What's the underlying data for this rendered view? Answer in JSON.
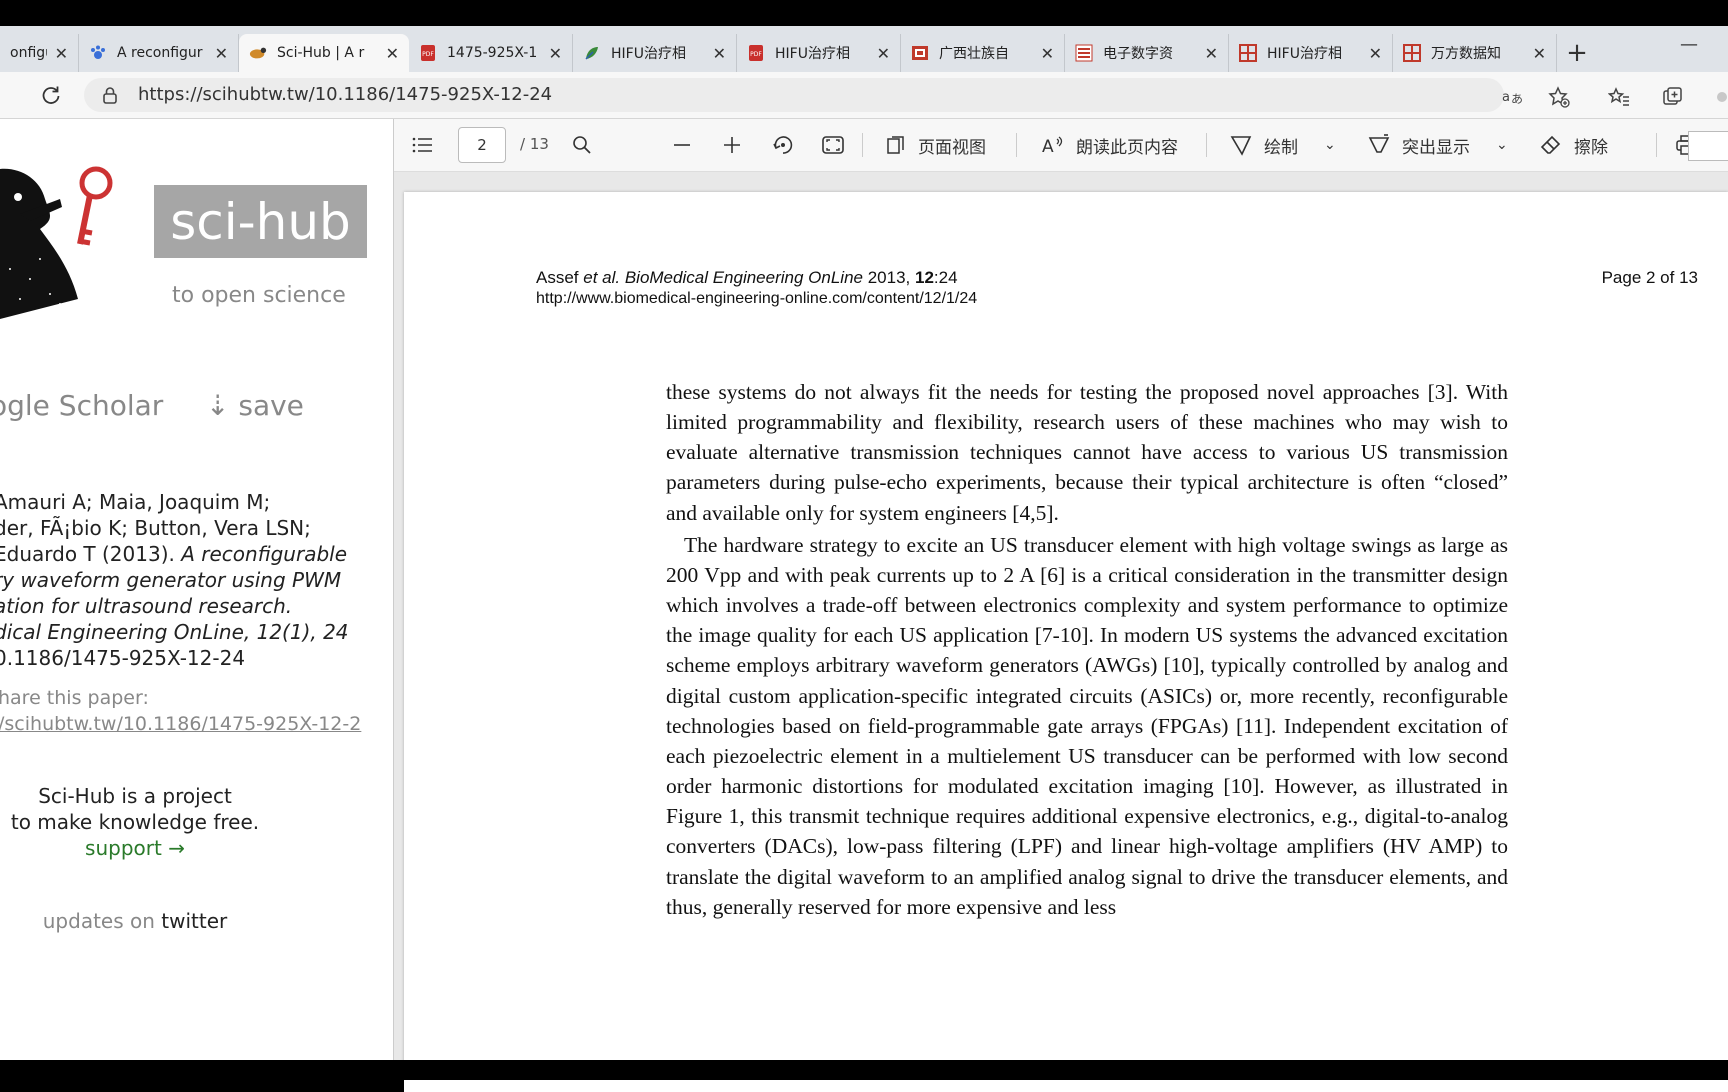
{
  "tabs": [
    {
      "label": "onfigur",
      "icon": "document-icon"
    },
    {
      "label": "A reconfigur",
      "icon": "paw-icon"
    },
    {
      "label": "Sci-Hub | A r",
      "icon": "scihub-icon",
      "active": true
    },
    {
      "label": "1475-925X-1",
      "icon": "pdf-icon"
    },
    {
      "label": "HIFU治疗相",
      "icon": "leaf-icon"
    },
    {
      "label": "HIFU治疗相",
      "icon": "pdf-icon"
    },
    {
      "label": "广西壮族自",
      "icon": "library-icon"
    },
    {
      "label": "电子数字资",
      "icon": "resource-icon"
    },
    {
      "label": "HIFU治疗相",
      "icon": "wanfang-icon"
    },
    {
      "label": "万方数据知",
      "icon": "wanfang-icon"
    }
  ],
  "address": {
    "url": "https://scihubtw.tw/10.1186/1475-925X-12-24"
  },
  "sidebar": {
    "brand": "sci-hub",
    "tagline": "to open science",
    "google_scholar": "ogle Scholar",
    "save": "⇣ save",
    "citation": {
      "line1": "Amauri A; Maia, Joaquim M;",
      "line2": "der, FÃ¡bio K; Button, Vera LSN;",
      "line3_prefix": "Eduardo T (2013). ",
      "line3_italic": "A reconfigurable",
      "line4": "ry waveform generator using PWM",
      "line5": "ation for ultrasound research.",
      "line6": "dical Engineering OnLine, 12(1), 24",
      "line7": "0.1186/1475-925X-12-24"
    },
    "share_label": "hare this paper:",
    "share_link": "/scihubtw.tw/10.1186/1475-925X-12-2",
    "project_line1": "Sci-Hub is a project",
    "project_line2": "to make knowledge free.",
    "support": "support →",
    "updates_prefix": "updates on ",
    "updates_link": "twitter"
  },
  "pdf_toolbar": {
    "current_page": "2",
    "total_pages": "/ 13",
    "page_view": "页面视图",
    "read_aloud": "朗读此页内容",
    "draw": "绘制",
    "highlight": "突出显示",
    "erase": "擦除"
  },
  "pdf_page": {
    "header_line1_a": "Assef ",
    "header_line1_b": "et al. BioMedical Engineering OnLine",
    "header_line1_c": " 2013, ",
    "header_line1_d": "12",
    "header_line1_e": ":24",
    "header_line2": "http://www.biomedical-engineering-online.com/content/12/1/24",
    "page_label": "Page 2 of 13",
    "para1": "these systems do not always fit the needs for testing the proposed novel approaches [3]. With limited programmability and flexibility, research users of these machines who may wish to evaluate alternative transmission techniques cannot have access to various US transmission parameters during pulse-echo experiments, because their typical architecture is often “closed” and available only for system engineers [4,5].",
    "para2": "The hardware strategy to excite an US transducer element with high voltage swings as large as 200 Vpp and with peak currents up to 2 A [6] is a critical consideration in the transmitter design which involves a trade-off between electronics complexity and system performance to optimize the image quality for each US application [7-10]. In modern US systems the advanced excitation scheme employs arbitrary waveform generators (AWGs) [10], typically controlled by analog and digital custom application-specific integrated circuits (ASICs) or, more recently, reconfigurable technologies based on field-programmable gate arrays (FPGAs) [11]. Independent excitation of each piezoelectric element in a multielement US transducer can be performed with low second order harmonic distortions for modulated excitation imaging [10]. However, as illustrated in Figure 1, this transmit technique requires additional expensive electronics, e.g., digital-to-analog converters (DACs), low-pass filtering (LPF) and linear high-voltage amplifiers (HV AMP) to translate the digital waveform to an amplified analog signal to drive the transducer elements, and thus, generally reserved for more expensive and less"
  },
  "colors": {
    "support_link": "#2a7a2a",
    "brand_box": "#a6a6a6",
    "tabbar": "#dfe3e8"
  }
}
